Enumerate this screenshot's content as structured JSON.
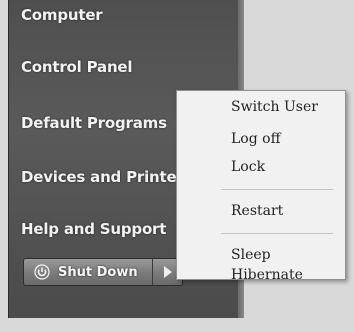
{
  "start_menu": {
    "items": [
      {
        "label": "Computer"
      },
      {
        "label": "Control Panel"
      },
      {
        "label": "Default Programs"
      },
      {
        "label": "Devices and Printers"
      },
      {
        "label": "Help and Support"
      }
    ],
    "shutdown": {
      "label": "Shut Down",
      "icon": "power-icon",
      "arrow_icon": "chevron-right-icon"
    }
  },
  "power_submenu": {
    "items": [
      {
        "label": "Switch User"
      },
      {
        "label": "Log off"
      },
      {
        "label": "Lock"
      },
      {
        "label": "Restart"
      },
      {
        "label": "Sleep"
      },
      {
        "label": "Hibernate"
      }
    ]
  },
  "colors": {
    "menu_background": "#555555",
    "submenu_background": "#f1f1f1",
    "menu_text": "#f2f2f2",
    "submenu_text": "#222222"
  }
}
